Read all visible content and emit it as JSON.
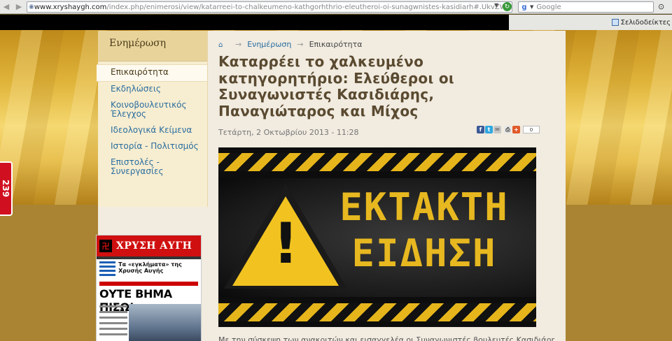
{
  "browser": {
    "url_host": "www.xryshaygh.com",
    "url_path": "/index.php/enimerosi/view/katarreei-to-chalkeumeno-kathgorhthrio-eleutheroi-oi-sunagwnistes-kasidiarh#.UkvZWmnc",
    "search_placeholder": "Google",
    "search_engine_glyph": "g",
    "bookmarks_label": "Σελιδοδείκτες"
  },
  "sidebar": {
    "heading": "Ενημέρωση",
    "items": [
      {
        "label": "Επικαιρότητα",
        "active": true
      },
      {
        "label": "Εκδηλώσεις"
      },
      {
        "label": "Κοινοβουλευτικός Έλεγχος"
      },
      {
        "label": "Ιδεολογικά Κείμενα"
      },
      {
        "label": "Ιστορία - Πολιτισμός"
      },
      {
        "label": "Επιστολές - Συνεργασίες"
      }
    ],
    "newspaper": {
      "masthead": "ΧΡΥΣΗ ΑΥΓΗ",
      "subhead": "Τα «εγκλήματα» της Χρυσής Αυγής",
      "headline": "ΟΥΤΕ ΒΗΜΑ ΠΙΣΩ!"
    }
  },
  "side_tab": {
    "label": "239"
  },
  "breadcrumb": {
    "home_icon": "home-icon",
    "section": "Ενημέρωση",
    "current": "Επικαιρότητα"
  },
  "article": {
    "title": "Καταρρέει το χαλκευμένο κατηγορητήριο: Ελεύθεροι οι Συναγωνιστές Κασιδιάρης, Παναγιώταρος και Μίχος",
    "date": "Τετάρτη, 2 Οκτωβρίου 2013 - 11:28",
    "share_count": "0",
    "hero_line1": "ΕΚΤΑΚΤΗ",
    "hero_line2": "ΕΙΔΗΣΗ",
    "body_start": "Με την σύσκεψη των ανακριτών και εισαγγελέα οι Συναγωνιστές βουλευτές Κασιδιάρης"
  },
  "colors": {
    "accent_link": "#2a6ea0",
    "hazard_yellow": "#e5b51b",
    "title_brown": "#5a4a30"
  }
}
